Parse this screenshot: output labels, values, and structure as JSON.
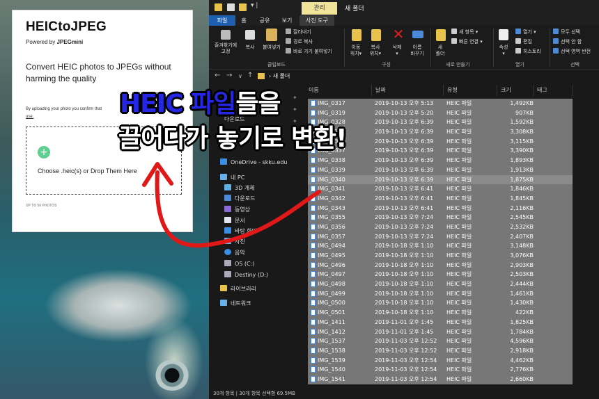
{
  "website": {
    "title": "HEICtoJPEG",
    "powered_prefix": "Powered by ",
    "powered_brand": "JPEGmini",
    "headline": "Convert HEIC photos to JPEGs without harming the quality",
    "consent_text": "By uploading your photo you confirm that",
    "consent_link": "use.",
    "drop_label": "Choose .heic(s) or Drop Them Here",
    "upload_limit": "UP TO 50 PHOTOS",
    "add_icon_glyph": "+",
    "accent_color": "#5fcf8f"
  },
  "explorer": {
    "titlebar": {
      "manage_tab": "관리",
      "path_title": "새 폴더"
    },
    "tabs": [
      "파일",
      "홈",
      "공유",
      "보기",
      "사진 도구"
    ],
    "ribbon": {
      "clipboard": {
        "pin": "즐겨찾기에\n고정",
        "copy": "복사",
        "paste": "붙여넣기",
        "cut": "잘라내기",
        "copy_path": "경로 복사",
        "paste_shortcut": "바로 가기 붙여넣기",
        "group": "클립보드"
      },
      "organize": {
        "move_to": "이동\n위치▾",
        "copy_to": "복사\n위치▾",
        "delete": "삭제\n▾",
        "rename": "이름\n바꾸기",
        "group": "구성"
      },
      "new": {
        "new_folder": "새\n폴더",
        "new_item": "새 항목 ▾",
        "easy_access": "빠른 연결 ▾",
        "group": "새로 만들기"
      },
      "open": {
        "properties": "속성\n▾",
        "open": "열기 ▾",
        "edit": "편집",
        "history": "히스토리",
        "group": "열기"
      },
      "select": {
        "select_all": "모두 선택",
        "select_none": "선택 안 함",
        "invert": "선택 영역 반전",
        "group": "선택"
      }
    },
    "address": {
      "path": "새 폴더"
    },
    "nav_pane": [
      {
        "label": "다운로드",
        "icon": "download-icon"
      },
      {
        "label": "OneDrive - skku.edu",
        "icon": "onedrive-icon"
      },
      {
        "label": "내 PC",
        "icon": "pc-icon"
      },
      {
        "label": "3D 개체",
        "icon": "3d-objects-icon"
      },
      {
        "label": "다운로드",
        "icon": "download-icon"
      },
      {
        "label": "동영상",
        "icon": "video-icon"
      },
      {
        "label": "문서",
        "icon": "documents-icon"
      },
      {
        "label": "바탕 화면",
        "icon": "desktop-icon"
      },
      {
        "label": "사진",
        "icon": "pictures-icon"
      },
      {
        "label": "음악",
        "icon": "music-icon"
      },
      {
        "label": "OS (C:)",
        "icon": "drive-icon"
      },
      {
        "label": "Destiny (D:)",
        "icon": "drive-icon"
      },
      {
        "label": "라이브러리",
        "icon": "library-icon"
      },
      {
        "label": "네트워크",
        "icon": "network-icon"
      }
    ],
    "columns": [
      "이름",
      "날짜",
      "유형",
      "크기",
      "태그"
    ],
    "files": [
      [
        "IMG_0317",
        "2019-10-13 오후 5:13",
        "HEIC 파일",
        "1,492KB"
      ],
      [
        "IMG_0319",
        "2019-10-13 오후 5:20",
        "HEIC 파일",
        "907KB"
      ],
      [
        "IMG_0328",
        "2019-10-13 오후 6:39",
        "HEIC 파일",
        "1,592KB"
      ],
      [
        "IMG_0329",
        "2019-10-13 오후 6:39",
        "HEIC 파일",
        "3,308KB"
      ],
      [
        "IMG_0330",
        "2019-10-13 오후 6:39",
        "HEIC 파일",
        "3,115KB"
      ],
      [
        "IMG_0337",
        "2019-10-13 오후 6:39",
        "HEIC 파일",
        "3,390KB"
      ],
      [
        "IMG_0338",
        "2019-10-13 오후 6:39",
        "HEIC 파일",
        "1,893KB"
      ],
      [
        "IMG_0339",
        "2019-10-13 오후 6:39",
        "HEIC 파일",
        "1,913KB"
      ],
      [
        "IMG_0340",
        "2019-10-13 오후 6:39",
        "HEIC 파일",
        "1,875KB"
      ],
      [
        "IMG_0341",
        "2019-10-13 오후 6:41",
        "HEIC 파일",
        "1,846KB"
      ],
      [
        "IMG_0342",
        "2019-10-13 오후 6:41",
        "HEIC 파일",
        "1,845KB"
      ],
      [
        "IMG_0343",
        "2019-10-13 오후 6:41",
        "HEIC 파일",
        "2,116KB"
      ],
      [
        "IMG_0355",
        "2019-10-13 오후 7:24",
        "HEIC 파일",
        "2,545KB"
      ],
      [
        "IMG_0356",
        "2019-10-13 오후 7:24",
        "HEIC 파일",
        "2,532KB"
      ],
      [
        "IMG_0357",
        "2019-10-13 오후 7:24",
        "HEIC 파일",
        "2,407KB"
      ],
      [
        "IMG_0494",
        "2019-10-18 오후 1:10",
        "HEIC 파일",
        "3,148KB"
      ],
      [
        "IMG_0495",
        "2019-10-18 오후 1:10",
        "HEIC 파일",
        "3,076KB"
      ],
      [
        "IMG_0496",
        "2019-10-18 오후 1:10",
        "HEIC 파일",
        "2,903KB"
      ],
      [
        "IMG_0497",
        "2019-10-18 오후 1:10",
        "HEIC 파일",
        "2,503KB"
      ],
      [
        "IMG_0498",
        "2019-10-18 오후 1:10",
        "HEIC 파일",
        "2,444KB"
      ],
      [
        "IMG_0499",
        "2019-10-18 오후 1:10",
        "HEIC 파일",
        "1,461KB"
      ],
      [
        "IMG_0500",
        "2019-10-18 오후 1:10",
        "HEIC 파일",
        "1,430KB"
      ],
      [
        "IMG_0501",
        "2019-10-18 오후 1:10",
        "HEIC 파일",
        "422KB"
      ],
      [
        "IMG_1411",
        "2019-11-01 오후 1:45",
        "HEIC 파일",
        "1,825KB"
      ],
      [
        "IMG_1412",
        "2019-11-01 오후 1:45",
        "HEIC 파일",
        "1,784KB"
      ],
      [
        "IMG_1537",
        "2019-11-03 오후 12:52",
        "HEIC 파일",
        "4,596KB"
      ],
      [
        "IMG_1538",
        "2019-11-03 오후 12:52",
        "HEIC 파일",
        "2,918KB"
      ],
      [
        "IMG_1539",
        "2019-11-03 오후 12:54",
        "HEIC 파일",
        "4,462KB"
      ],
      [
        "IMG_1540",
        "2019-11-03 오후 12:54",
        "HEIC 파일",
        "2,776KB"
      ],
      [
        "IMG_1541",
        "2019-11-03 오후 12:54",
        "HEIC 파일",
        "2,660KB"
      ]
    ],
    "highlighted_file": "IMG_0340",
    "status": "30개 항목  |  30개 항목 선택함 69.5MB"
  },
  "overlay": {
    "line1_highlight": "HEIC 파일",
    "line1_rest": "들을",
    "line2": "끌어다가 놓기로 변환!",
    "highlight_color": "#2626e6",
    "arrow_color": "#e01818"
  }
}
